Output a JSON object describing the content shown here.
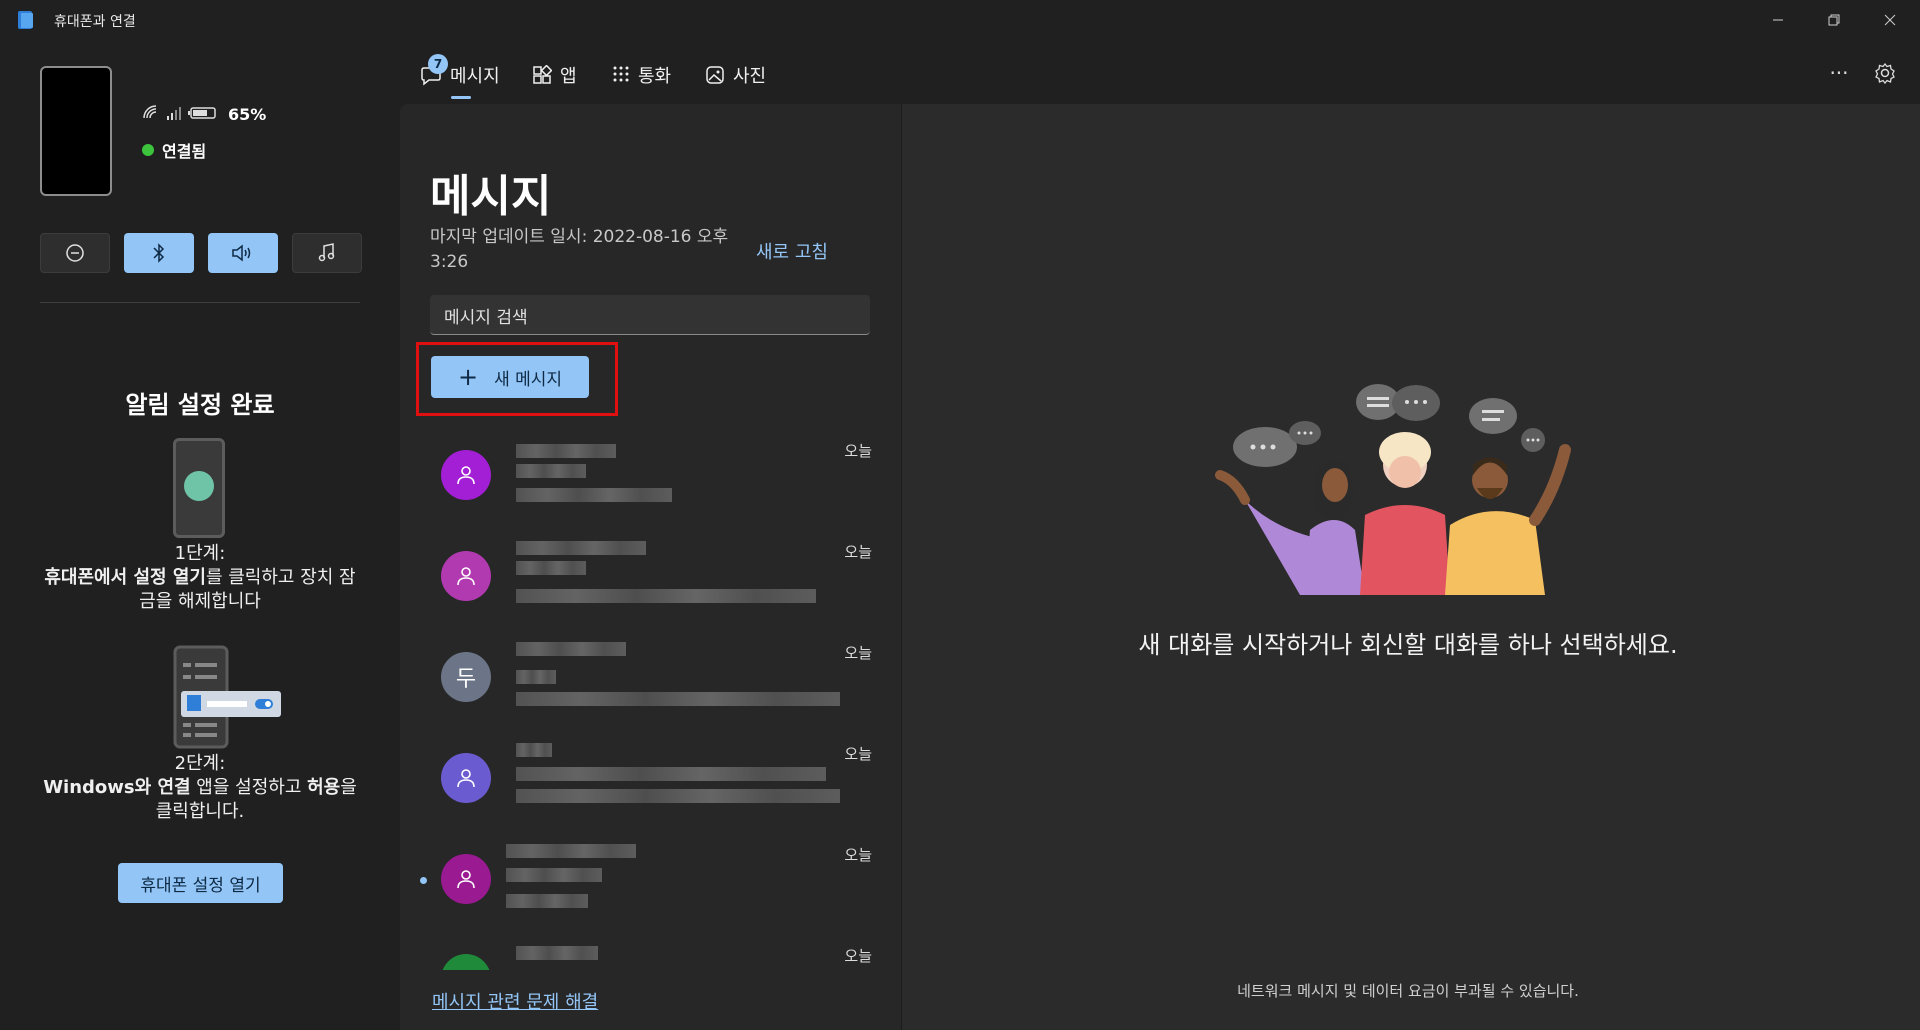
{
  "window": {
    "title": "휴대폰과 연결",
    "controls": [
      "minimize-icon",
      "restore-icon",
      "close-icon"
    ]
  },
  "phone_status": {
    "battery": "65%",
    "connection": "연결됨",
    "quick_actions": [
      {
        "name": "do-not-disturb",
        "active": false
      },
      {
        "name": "bluetooth",
        "active": true
      },
      {
        "name": "audio",
        "active": true
      },
      {
        "name": "music",
        "active": false
      }
    ]
  },
  "notification_setup": {
    "title": "알림 설정 완료",
    "step1_label": "1단계:",
    "step1_bold": "휴대폰에서 설정 열기",
    "step1_rest": "를 클릭하고 장치 잠금을 해제합니다",
    "step2_label": "2단계:",
    "step2_bold1": "Windows와 연결",
    "step2_mid": " 앱을 설정하고 ",
    "step2_bold2": "허용",
    "step2_rest": "을 클릭합니다.",
    "open_settings_button": "휴대폰 설정 열기"
  },
  "nav": {
    "badge_count": "7",
    "tabs": [
      {
        "label": "메시지",
        "icon": "chat-icon",
        "selected": true
      },
      {
        "label": "앱",
        "icon": "apps-icon",
        "selected": false
      },
      {
        "label": "통화",
        "icon": "dialpad-icon",
        "selected": false
      },
      {
        "label": "사진",
        "icon": "photos-icon",
        "selected": false
      }
    ],
    "more_icon": "more-icon",
    "settings_icon": "gear-icon"
  },
  "messages": {
    "title": "메시지",
    "last_update": "마지막 업데이트 일시: 2022-08-16 오후 3:26",
    "refresh": "새로 고침",
    "search_placeholder": "메시지 검색",
    "new_message": "새 메시지",
    "conversations": [
      {
        "avatar_text": "",
        "avatar_color": "#a21fd6",
        "time": "오늘",
        "unread": false
      },
      {
        "avatar_text": "",
        "avatar_color": "#b23ab0",
        "time": "오늘",
        "unread": false
      },
      {
        "avatar_text": "두",
        "avatar_color": "#6b7587",
        "time": "오늘",
        "unread": false
      },
      {
        "avatar_text": "",
        "avatar_color": "#6a5cd0",
        "time": "오늘",
        "unread": false
      },
      {
        "avatar_text": "",
        "avatar_color": "#9a1a92",
        "time": "오늘",
        "unread": true
      },
      {
        "avatar_text": "",
        "avatar_color": "#1f8a3a",
        "time": "오늘",
        "unread": false
      }
    ],
    "troubleshoot": "메시지 관련 문제 해결"
  },
  "empty_state": {
    "text": "새 대화를 시작하거나 회신할 대화를 하나 선택하세요.",
    "footer": "네트워크 메시지 및 데이터 요금이 부과될 수 있습니다."
  }
}
